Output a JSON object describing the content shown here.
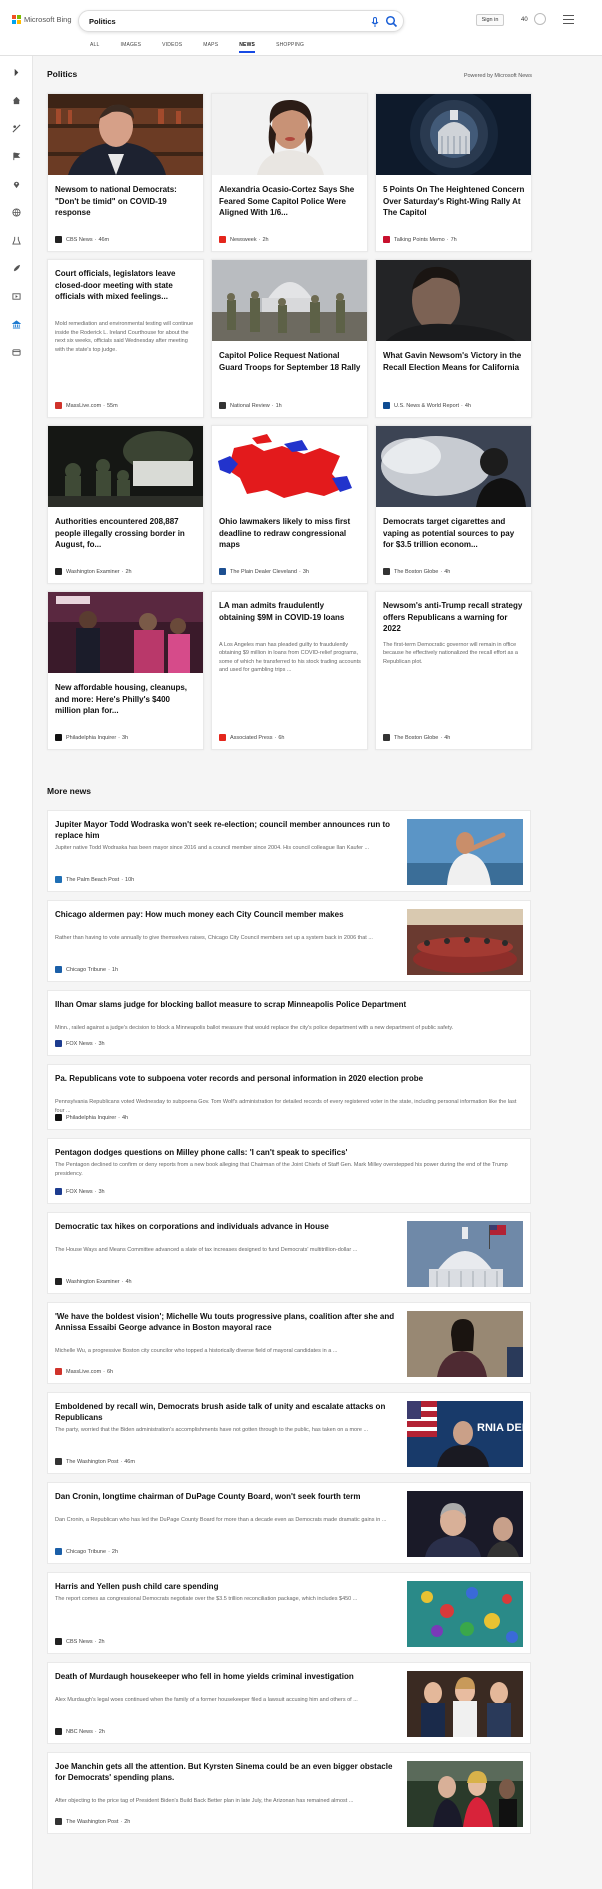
{
  "header": {
    "logo_text": "Microsoft Bing",
    "search_value": "Politics",
    "sign_in": "Sign in",
    "points": "40",
    "tabs": [
      "ALL",
      "IMAGES",
      "VIDEOS",
      "MAPS",
      "NEWS",
      "SHOPPING"
    ],
    "active_tab": "NEWS"
  },
  "section": {
    "title": "Politics",
    "powered_by": "Powered by Microsoft News"
  },
  "cards": [
    {
      "title": "Newsom to national Democrats: \"Don't be timid\" on COVID-19 response",
      "source": "CBS News",
      "time": "46m",
      "favicon_color": "#222222",
      "image": "newsom-bookshelf"
    },
    {
      "title": "Alexandria Ocasio-Cortez Says She Feared Some Capitol Police Were Aligned With 1/6...",
      "source": "Newsweek",
      "time": "2h",
      "favicon_color": "#e4261c",
      "image": "aoc-portrait"
    },
    {
      "title": "5 Points On The Heightened Concern Over Saturday's Right-Wing Rally At The Capitol",
      "source": "Talking Points Memo",
      "time": "7h",
      "favicon_color": "#c8102e",
      "image": "capitol-dome-fisheye"
    },
    {
      "title": "Court officials, legislators leave closed-door meeting with state officials with mixed feelings...",
      "desc": "Mold remediation and environmental testing will continue inside the Roderick L. Ireland Courthouse for about the next six weeks, officials said Wednesday after meeting with the state's top judge.",
      "source": "MassLive.com",
      "time": "55m",
      "favicon_color": "#d0332b",
      "image": ""
    },
    {
      "title": "Capitol Police Request National Guard Troops for September 18 Rally",
      "source": "National Review",
      "time": "1h",
      "favicon_color": "#333333",
      "image": "guard-troops"
    },
    {
      "title": "What Gavin Newsom's Victory in the Recall Election Means for California",
      "source": "U.S. News & World Report",
      "time": "4h",
      "favicon_color": "#0e4c92",
      "image": "newsom-dark"
    },
    {
      "title": "Authorities encountered 208,887 people illegally crossing border in August, fo...",
      "source": "Washington Examiner",
      "time": "2h",
      "favicon_color": "#222222",
      "image": "border-night"
    },
    {
      "title": "Ohio lawmakers likely to miss first deadline to redraw congressional maps",
      "source": "The Plain Dealer Cleveland",
      "time": "3h",
      "favicon_color": "#1d4f91",
      "image": "ohio-map"
    },
    {
      "title": "Democrats target cigarettes and vaping as potential sources to pay for $3.5 trillion econom...",
      "source": "The Boston Globe",
      "time": "4h",
      "favicon_color": "#333333",
      "image": "vaping"
    },
    {
      "title": "New affordable housing, cleanups, and more: Here's Philly's $400 million plan for...",
      "source": "Philadelphia Inquirer",
      "time": "3h",
      "favicon_color": "#111111",
      "image": "philly-podium"
    },
    {
      "title": "LA man admits fraudulently obtaining $9M in COVID-19 loans",
      "desc": "A Los Angeles man has pleaded guilty to fraudulently obtaining $9 million in loans from COVID-relief programs, some of which he transferred to his stock trading accounts and used for gambling trips ...",
      "source": "Associated Press",
      "time": "6h",
      "favicon_color": "#e4261c",
      "image": ""
    },
    {
      "title": "Newsom's anti-Trump recall strategy offers Republicans a warning for 2022",
      "desc": "The first-term Democratic governor will remain in office because he effectively nationalized the recall effort as a Republican plot.",
      "source": "The Boston Globe",
      "time": "4h",
      "favicon_color": "#333333",
      "image": ""
    }
  ],
  "more_news": {
    "title": "More news",
    "items": [
      {
        "title": "Jupiter Mayor Todd Wodraska won't seek re-election; council member announces run to replace him",
        "desc": "Jupiter native Todd Wodraska has been mayor since 2016 and a council member since 2004. His council colleague Ilan Kaufer ...",
        "source": "The Palm Beach Post",
        "time": "10h",
        "favicon_color": "#1f6fb5",
        "image": "speaker-sky"
      },
      {
        "title": "Chicago aldermen pay: How much money each City Council member makes",
        "desc": "Rather than having to vote annually to give themselves raises, Chicago City Council members set up a system back in 2006 that ...",
        "source": "Chicago Tribune",
        "time": "1h",
        "favicon_color": "#1b5fa8",
        "image": "council-chamber"
      },
      {
        "title": "Ilhan Omar slams judge for blocking ballot measure to scrap Minneapolis Police Department",
        "desc": "Minn., railed against a judge's decision to block a Minneapolis ballot measure that would replace the city's police department with a new department of public safety.",
        "source": "FOX News",
        "time": "3h",
        "favicon_color": "#1d3c8f",
        "image": ""
      },
      {
        "title": "Pa. Republicans vote to subpoena voter records and personal information in 2020 election probe",
        "desc": "Pennsylvania Republicans voted Wednesday to subpoena Gov. Tom Wolf's administration for detailed records of every registered voter in the state, including personal information like the last four ...",
        "source": "Philadelphia Inquirer",
        "time": "4h",
        "favicon_color": "#111111",
        "image": ""
      },
      {
        "title": "Pentagon dodges questions on Milley phone calls: 'I can't speak to specifics'",
        "desc": "The Pentagon declined to confirm or deny reports from a new book alleging that Chairman of the Joint Chiefs of Staff Gen. Mark Milley overstepped his power during the end of the Trump presidency.",
        "source": "FOX News",
        "time": "3h",
        "favicon_color": "#1d3c8f",
        "image": ""
      },
      {
        "title": "Democratic tax hikes on corporations and individuals advance in House",
        "desc": "The House Ways and Means Committee advanced a slate of tax increases designed to fund Democrats' multitrillion-dollar ...",
        "source": "Washington Examiner",
        "time": "4h",
        "favicon_color": "#222222",
        "image": "capitol-flag"
      },
      {
        "title": "'We have the boldest vision'; Michelle Wu touts progressive plans, coalition after she and Annissa Essaibi George advance in Boston mayoral race",
        "desc": "Michelle Wu, a progressive Boston city councilor who topped a historically diverse field of mayoral candidates in a ...",
        "source": "MassLive.com",
        "time": "6h",
        "favicon_color": "#d0332b",
        "image": "wu-portrait"
      },
      {
        "title": "Emboldened by recall win, Democrats brush aside talk of unity and escalate attacks on Republicans",
        "desc": "The party, worried that the Biden administration's accomplishments have not gotten through to the public, has taken on a more ...",
        "source": "The Washington Post",
        "time": "46m",
        "favicon_color": "#333333",
        "image": "newsom-rally"
      },
      {
        "title": "Dan Cronin, longtime chairman of DuPage County Board, won't seek fourth term",
        "desc": "Dan Cronin, a Republican who has led the DuPage County Board for more than a decade even as Democrats made dramatic gains in ...",
        "source": "Chicago Tribune",
        "time": "2h",
        "favicon_color": "#1b5fa8",
        "image": "cronin"
      },
      {
        "title": "Harris and Yellen push child care spending",
        "desc": "The report comes as congressional Democrats negotiate over the $3.5 trillion reconciliation package, which includes $450 ...",
        "source": "CBS News",
        "time": "2h",
        "favicon_color": "#222222",
        "image": "childcare-toys"
      },
      {
        "title": "Death of Murdaugh housekeeper who fell in home yields criminal investigation",
        "desc": "Alex Murdaugh's legal woes continued when the family of a former housekeeper filed a lawsuit accusing him and others of ...",
        "source": "NBC News",
        "time": "2h",
        "favicon_color": "#222222",
        "image": "murdaugh-family"
      },
      {
        "title": "Joe Manchin gets all the attention. But Kyrsten Sinema could be an even bigger obstacle for Democrats' spending plans.",
        "desc": "After objecting to the price tag of President Biden's Build Back Better plan in late July, the Arizonan has remained almost ...",
        "source": "The Washington Post",
        "time": "2h",
        "favicon_color": "#333333",
        "image": "sinema-event"
      }
    ]
  },
  "sidebar": {
    "icons": [
      "expand-icon",
      "home-icon",
      "sports-icon",
      "flag-icon",
      "location-icon",
      "world-icon",
      "science-icon",
      "rocket-icon",
      "movie-icon",
      "bank-icon",
      "card-icon"
    ]
  }
}
